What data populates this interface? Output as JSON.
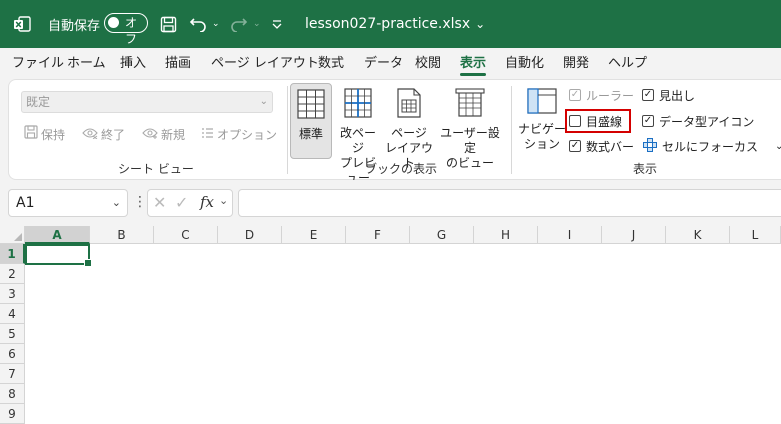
{
  "titlebar": {
    "autosave_label": "自動保存",
    "autosave_state": "オフ",
    "filename": "lesson027-practice.xlsx",
    "filename_chevron": "⌄",
    "accent_color": "#1e7145"
  },
  "menu": {
    "tabs": [
      "ファイル",
      "ホーム",
      "挿入",
      "描画",
      "ページ レイアウト",
      "数式",
      "データ",
      "校閲",
      "表示",
      "自動化",
      "開発",
      "ヘルプ"
    ],
    "active": "表示"
  },
  "ribbon": {
    "sheet_view": {
      "select_value": "既定",
      "keep_label": "保持",
      "exit_label": "終了",
      "new_label": "新規",
      "options_label": "オプション",
      "group_label": "シート ビュー"
    },
    "workbook_views": {
      "normal_label": "標準",
      "page_break_label_1": "改ページ",
      "page_break_label_2": "プレビュー",
      "page_layout_label_1": "ページ",
      "page_layout_label_2": "レイアウト",
      "custom_label_1": "ユーザー設定",
      "custom_label_2": "のビュー",
      "group_label": "ブックの表示"
    },
    "show": {
      "navigation_label_1": "ナビゲー",
      "navigation_label_2": "ション",
      "ruler_label": "ルーラー",
      "ruler_checked": true,
      "ruler_disabled": true,
      "gridlines_label": "目盛線",
      "gridlines_checked": false,
      "formula_bar_label": "数式バー",
      "formula_bar_checked": true,
      "headings_label": "見出し",
      "headings_checked": true,
      "data_type_icons_label": "データ型アイコン",
      "data_type_icons_checked": true,
      "focus_cell_label": "セルにフォーカス",
      "focus_cell_chevron": "⌄",
      "group_label": "表示",
      "check_mark": "✓"
    }
  },
  "formula_bar": {
    "name_box": "A1",
    "fx_label": "fx",
    "formula_value": ""
  },
  "grid": {
    "columns": [
      "A",
      "B",
      "C",
      "D",
      "E",
      "F",
      "G",
      "H",
      "I",
      "J",
      "K",
      "L"
    ],
    "rows": [
      "1",
      "2",
      "3",
      "4",
      "5",
      "6",
      "7",
      "8",
      "9"
    ],
    "selected_cell": "A1"
  }
}
